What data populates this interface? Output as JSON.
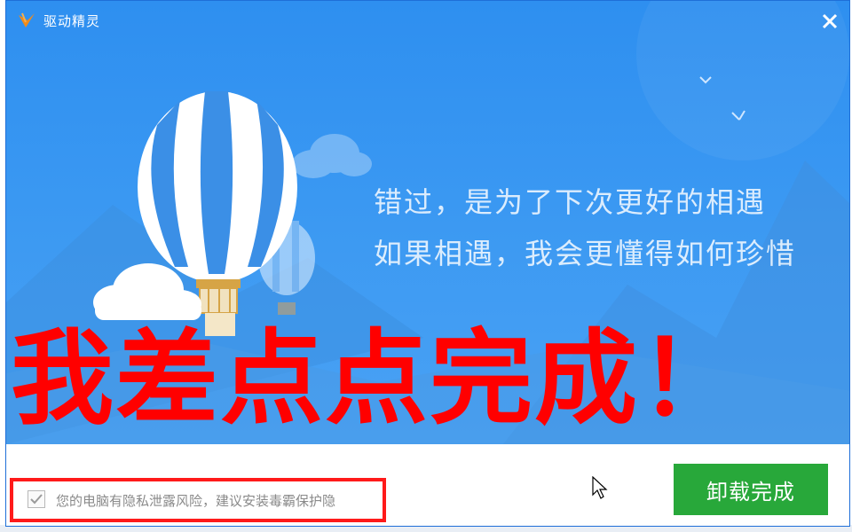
{
  "window": {
    "title": "驱动精灵",
    "close_icon": "close-icon",
    "logo_icon": "logo-icon"
  },
  "hero": {
    "line1": "错过，是为了下次更好的相遇",
    "line2": "如果相遇，我会更懂得如何珍惜"
  },
  "overlay": {
    "text": "我差点点完成！",
    "color": "#ff0000"
  },
  "footer": {
    "checkbox_checked": true,
    "privacy_label": "您的电脑有隐私泄露风险，建议安装毒霸保护隐",
    "finish_button": "卸载完成"
  },
  "colors": {
    "hero_blue": "#2e8ff0",
    "finish_green": "#28a83a",
    "highlight_red": "#ff1a1a"
  }
}
